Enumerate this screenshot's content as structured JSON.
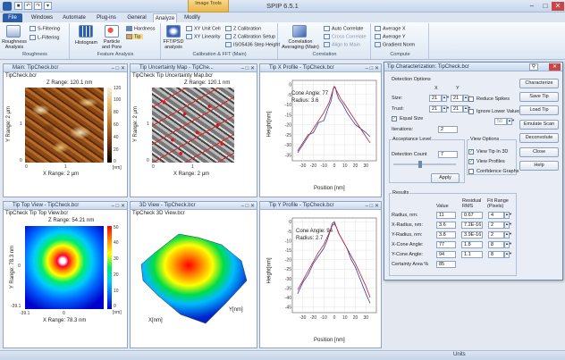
{
  "app": {
    "title": "SPIP 6.5.1",
    "context_tab": "Image Tools"
  },
  "quick_access": [
    "■",
    "↶",
    "↷",
    "▾"
  ],
  "window_controls": {
    "minimize": "–",
    "maximize": "□",
    "close": "✕"
  },
  "tabs": [
    {
      "label": "File"
    },
    {
      "label": "Windows"
    },
    {
      "label": "Automate"
    },
    {
      "label": "Plug-ins"
    },
    {
      "label": "General"
    },
    {
      "label": "Analyze"
    },
    {
      "label": "Modify"
    }
  ],
  "ribbon": {
    "roughness": {
      "label": "Roughness",
      "big": "Roughness Analysis",
      "items": [
        "S-Filtering",
        "L-Filtering"
      ]
    },
    "feature": {
      "label": "Feature Analysis",
      "histogram": "Histogram",
      "particle": "Particle and Pore",
      "items": [
        "Hardness",
        "Tip"
      ]
    },
    "calibration": {
      "label": "Calibration & FFT (Main)",
      "fft": "FFT/PSD analysis",
      "col1": [
        "XY Unit Cell",
        "XY Linearity"
      ],
      "col2": [
        "Z Calibration",
        "Z Calibration Setup",
        "ISO5436 Step Height"
      ]
    },
    "correlation": {
      "label": "Correlation",
      "big": "Correlation Averaging (Main)",
      "items": [
        "Auto Correlate",
        "Cross Correlate",
        "Align to Main"
      ]
    },
    "compute": {
      "label": "Compute",
      "items": [
        "Average X",
        "Average Y",
        "Gradient Norm"
      ]
    }
  },
  "windows": {
    "main": {
      "title": "Main: TipCheck.bcr",
      "subtitle": "TipCheck.bcr",
      "z_range": "Z Range: 120.1 nm",
      "x_range": "X Range: 2 μm",
      "y_range": "Y Range: 2 μm",
      "xticks": [
        "0",
        "1"
      ],
      "yticks": [
        "0",
        "1"
      ],
      "scale": [
        "120",
        "100",
        "80",
        "60",
        "40",
        "20",
        "0"
      ],
      "unit": "[nm]"
    },
    "uncertainty": {
      "title": "Tip Uncertainty Map - TipChe...",
      "subtitle": "TipCheck Tip Uncertainty Map.bcr",
      "z_range": "Z Range: 120.1 nm",
      "x_range": "X Range: 2 μm",
      "y_range": "Y Range: 2 μm",
      "xticks": [
        "0",
        "1"
      ],
      "yticks": [
        "0",
        "1"
      ]
    },
    "xprofile": {
      "title": "Tip X Profile - TipCheck.bcr",
      "cone_angle": "Cone Angle:  77",
      "radius": "Radius:  3.6",
      "ylabel": "Height[nm]",
      "xlabel": "Position [nm]",
      "xticks": [
        "-30",
        "-20",
        "-10",
        "0",
        "10",
        "20",
        "30"
      ],
      "yticks": [
        "0",
        "-5",
        "-10",
        "-15",
        "-20",
        "-25",
        "-30",
        "-35"
      ]
    },
    "topview": {
      "title": "Tip Top View - TipCheck.bcr",
      "subtitle": "TipCheck Tip Top View.bcr",
      "z_range": "Z Range: 54.21 nm",
      "x_range": "X Range: 78.3 nm",
      "y_range": "Y Range: 78.3 nm",
      "xticks": [
        "-39.1",
        "0"
      ],
      "yticks": [
        "0",
        "-39.1"
      ],
      "scale": [
        "50",
        "40",
        "30",
        "20",
        "10",
        "0"
      ],
      "unit": "[nm]"
    },
    "view3d": {
      "title": "3D View - TipCheck.bcr",
      "subtitle": "TipCheck 3D View.bcr",
      "xaxis": "X[nm]",
      "yaxis": "Y[nm]"
    },
    "yprofile": {
      "title": "Tip Y Profile - TipCheck.bcr",
      "cone_angle": "Cone Angle:  94",
      "radius": "Radius:  2.7",
      "ylabel": "Height[nm]",
      "xlabel": "Position [nm]",
      "xticks": [
        "-30",
        "-20",
        "-10",
        "0",
        "10",
        "20",
        "30"
      ],
      "yticks": [
        "0",
        "-5",
        "-10",
        "-15",
        "-20",
        "-25",
        "-30",
        "-35",
        "-40",
        "-45"
      ]
    }
  },
  "dialog": {
    "title": "Tip Characterization: TipCheck.bcr",
    "detection": {
      "label": "Detection Options",
      "x": "X",
      "y": "Y",
      "size": "Size:",
      "size_x": "21",
      "size_y": "21",
      "trust": "Trust:",
      "trust_x": "21",
      "trust_y": "21",
      "equal_size": "Equal Size",
      "iterations": "Iterations:",
      "iterations_val": "2",
      "reduce_spikes": "Reduce Spikes",
      "ignore_lower": "Ignore Lower Values",
      "ignore_val": "50"
    },
    "acceptance": {
      "label": "Acceptance Level",
      "detection_count": "Detection Count",
      "count_val": "7",
      "apply": "Apply"
    },
    "view": {
      "label": "View Options",
      "tip3d": "View Tip In 3D",
      "profiles": "View Profiles",
      "confidence": "Confidence Graphs"
    },
    "buttons": [
      "Characterize",
      "Save Tip",
      "Load Tip",
      "Emulate Scan",
      "Deconvolute",
      "Close",
      "Help"
    ],
    "results": {
      "label": "Results",
      "headers": [
        "Value",
        "Residual RMS",
        "Fit Range (Pixels)"
      ],
      "rows": [
        {
          "name": "Radius, nm:",
          "value": "11",
          "rms": "0.67",
          "fit": "4"
        },
        {
          "name": "X-Radius, nm:",
          "value": "3.6",
          "rms": "7.2E-16",
          "fit": "2"
        },
        {
          "name": "Y-Radius, nm:",
          "value": "3.8",
          "rms": "3.9E-16",
          "fit": "2"
        },
        {
          "name": "X-Cone Angle:",
          "value": "77",
          "rms": "1.8",
          "fit": "8"
        },
        {
          "name": "Y-Cone Angle:",
          "value": "94",
          "rms": "1.1",
          "fit": "8"
        },
        {
          "name": "Certainty Area %",
          "value": "85",
          "rms": "",
          "fit": ""
        }
      ]
    }
  },
  "status": {
    "units": "Units"
  },
  "chart_data": [
    {
      "type": "line",
      "name_key": "windows.xprofile",
      "xlim": [
        -40,
        40
      ],
      "ylim": [
        -38,
        2
      ],
      "series": [
        {
          "color": "#2b3fb0",
          "x": [
            -35,
            -30,
            -25,
            -20,
            -15,
            -10,
            -6,
            -3,
            -1,
            0,
            1,
            2,
            4,
            8,
            12,
            16,
            20,
            25,
            30,
            34
          ],
          "y": [
            -33,
            -29,
            -25,
            -24,
            -19,
            -18,
            -12,
            -8,
            -2,
            -1,
            -1.5,
            -4,
            -7,
            -10,
            -14,
            -17,
            -20,
            -22,
            -24,
            -26
          ]
        },
        {
          "color": "#c0202a",
          "x": [
            -35,
            -30,
            -25,
            -20,
            -15,
            -10,
            -5,
            -2,
            0,
            2,
            6,
            10,
            15,
            20,
            25,
            30,
            34
          ],
          "y": [
            -34,
            -30,
            -26,
            -22,
            -18,
            -14,
            -9,
            -4,
            -1,
            -3,
            -7,
            -10,
            -14,
            -18,
            -22,
            -26,
            -29
          ]
        }
      ]
    },
    {
      "type": "line",
      "name_key": "windows.yprofile",
      "xlim": [
        -40,
        40
      ],
      "ylim": [
        -48,
        2
      ],
      "series": [
        {
          "color": "#2b3fb0",
          "x": [
            -35,
            -30,
            -25,
            -20,
            -15,
            -10,
            -7,
            -4,
            -2,
            0,
            2,
            4,
            8,
            12,
            16,
            20,
            25,
            30,
            34
          ],
          "y": [
            -38,
            -32,
            -28,
            -22,
            -18,
            -14,
            -10,
            -5,
            -1,
            0,
            -3,
            -6,
            -10,
            -14,
            -20,
            -24,
            -31,
            -38,
            -43
          ]
        },
        {
          "color": "#c0202a",
          "x": [
            -35,
            -30,
            -25,
            -20,
            -15,
            -10,
            -5,
            -2,
            0,
            2,
            5,
            10,
            15,
            20,
            25,
            30,
            34
          ],
          "y": [
            -36,
            -31,
            -26,
            -21,
            -16,
            -12,
            -6,
            -2,
            -1,
            -3,
            -7,
            -12,
            -17,
            -22,
            -28,
            -34,
            -40
          ]
        }
      ]
    }
  ]
}
